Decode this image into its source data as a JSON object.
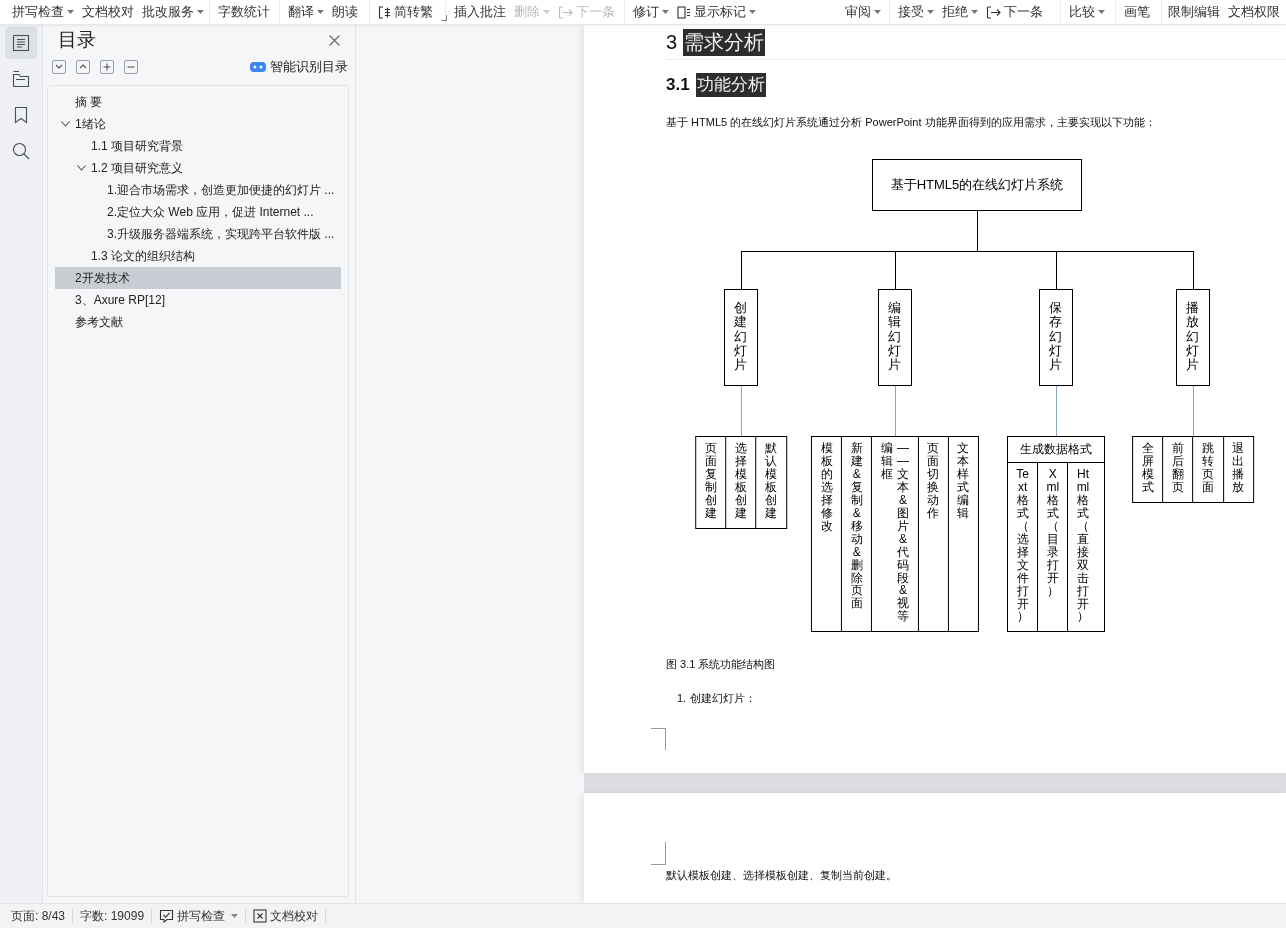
{
  "toolbar": {
    "groups": [
      {
        "launcher": false,
        "items": [
          {
            "kind": "text",
            "label": "拼写检查",
            "dropdown": true,
            "disabled": false
          },
          {
            "kind": "text",
            "label": "文档校对",
            "dropdown": false,
            "disabled": false
          },
          {
            "kind": "text",
            "label": "批改服务",
            "dropdown": true,
            "disabled": false
          }
        ]
      },
      {
        "launcher": false,
        "items": [
          {
            "kind": "text",
            "label": "字数统计",
            "dropdown": false,
            "disabled": false
          }
        ]
      },
      {
        "launcher": false,
        "items": [
          {
            "kind": "text",
            "label": "翻译",
            "dropdown": true,
            "disabled": false
          },
          {
            "kind": "text",
            "label": "朗读",
            "dropdown": false,
            "disabled": false
          }
        ]
      },
      {
        "launcher": true,
        "items": [
          {
            "kind": "convert",
            "label": "简转繁",
            "dropdown": false,
            "disabled": false
          }
        ]
      },
      {
        "launcher": false,
        "items": [
          {
            "kind": "text",
            "label": "插入批注",
            "dropdown": false,
            "disabled": false
          },
          {
            "kind": "text",
            "label": "删除",
            "dropdown": true,
            "disabled": true
          },
          {
            "kind": "next",
            "label": "下一条",
            "dropdown": false,
            "disabled": true
          }
        ]
      },
      {
        "launcher": false,
        "items": [
          {
            "kind": "text",
            "label": "修订",
            "dropdown": true,
            "disabled": false
          },
          {
            "kind": "markup",
            "label": "显示标记",
            "dropdown": true,
            "disabled": false
          },
          {
            "kind": "text",
            "label": "审阅",
            "dropdown": true,
            "disabled": false
          }
        ]
      },
      {
        "launcher": false,
        "items": [
          {
            "kind": "text",
            "label": "接受",
            "dropdown": true,
            "disabled": false
          },
          {
            "kind": "text",
            "label": "拒绝",
            "dropdown": true,
            "disabled": false
          },
          {
            "kind": "next",
            "label": "下一条",
            "dropdown": false,
            "disabled": false
          }
        ]
      },
      {
        "launcher": false,
        "items": [
          {
            "kind": "text",
            "label": "比较",
            "dropdown": true,
            "disabled": false
          }
        ]
      },
      {
        "launcher": false,
        "items": [
          {
            "kind": "text",
            "label": "画笔",
            "dropdown": false,
            "disabled": false
          }
        ]
      },
      {
        "launcher": false,
        "items": [
          {
            "kind": "text",
            "label": "限制编辑",
            "dropdown": false,
            "disabled": false
          },
          {
            "kind": "text",
            "label": "文档权限",
            "dropdown": false,
            "disabled": false
          }
        ]
      }
    ]
  },
  "rail": [
    {
      "kind": "outline",
      "selected": true
    },
    {
      "kind": "sections",
      "selected": false
    },
    {
      "kind": "bookmark",
      "selected": false
    },
    {
      "kind": "search",
      "selected": false
    }
  ],
  "outline_panel": {
    "title": "目录",
    "smart_button": "智能识别目录",
    "items": [
      {
        "label": "摘 要",
        "expanded": false,
        "selected": false
      },
      {
        "label": "1绪论",
        "expanded": true,
        "selected": false,
        "children": [
          {
            "label": "1.1 项目研究背景",
            "expanded": false,
            "selected": false
          },
          {
            "label": "1.2 项目研究意义",
            "expanded": true,
            "selected": false,
            "children": [
              {
                "label": "1.迎合市场需求，创造更加便捷的幻灯片 ...",
                "expanded": false,
                "selected": false
              },
              {
                "label": "2.定位大众 Web 应用，促进 Internet ...",
                "expanded": false,
                "selected": false
              },
              {
                "label": "3.升级服务器端系统，实现跨平台软件版 ...",
                "expanded": false,
                "selected": false
              }
            ]
          },
          {
            "label": "1.3 论文的组织结构",
            "expanded": false,
            "selected": false
          }
        ]
      },
      {
        "label": "2开发技术",
        "expanded": false,
        "selected": true
      },
      {
        "label": "3、Axure RP[12]",
        "expanded": false,
        "selected": false
      },
      {
        "label": "参考文献",
        "expanded": false,
        "selected": false
      }
    ]
  },
  "document": {
    "heading": {
      "number": "3",
      "title": "需求分析",
      "highlighted": true
    },
    "subheading": {
      "number": "3.1",
      "title": "功能分析",
      "highlighted": true
    },
    "intro": "基于 HTML5 的在线幻灯片系统通过分析 PowerPoint 功能界面得到的应用需求，主要实现以下功能：",
    "figure": {
      "root": "基于HTML5的在线幻灯片系统",
      "branches": [
        {
          "label": "创建幻灯片",
          "leaves": [
            {
              "lines": [
                "页面复制创建"
              ]
            },
            {
              "lines": [
                "选择模板创建"
              ]
            },
            {
              "lines": [
                "默认模板创建"
              ]
            }
          ]
        },
        {
          "label": "编辑幻灯片",
          "leaves": [
            {
              "lines": [
                "模板的选择修改"
              ]
            },
            {
              "lines": [
                "新建&复制&移动&删除页面"
              ]
            },
            {
              "lines": [
                "编辑框",
                "——文本&图片&代码段&视等"
              ]
            },
            {
              "lines": [
                "页面切换动作"
              ]
            },
            {
              "lines": [
                "文本样式编辑"
              ]
            }
          ]
        },
        {
          "label": "保存幻灯片",
          "header": "生成数据格式",
          "leaves": [
            {
              "lines": [
                "Text格式（选择文件打开）"
              ]
            },
            {
              "lines": [
                "Xml格式（目录打开）"
              ]
            },
            {
              "lines": [
                "Html格式（直接双击打开）"
              ]
            }
          ]
        },
        {
          "label": "播放幻灯片",
          "leaves": [
            {
              "lines": [
                "全屏模式"
              ]
            },
            {
              "lines": [
                "前后翻页"
              ]
            },
            {
              "lines": [
                "跳转页面"
              ]
            },
            {
              "lines": [
                "退出播放"
              ]
            }
          ]
        }
      ]
    },
    "caption": "图 3.1 系统功能结构图",
    "list_item": {
      "number": "1.",
      "text": "创建幻灯片："
    },
    "next_page_text": "默认模板创建、选择模板创建、复制当前创建。"
  },
  "status_bar": {
    "page": "页面: 8/43",
    "words": "字数: 19099",
    "spell_check": {
      "label": "拼写检查",
      "dropdown": true
    },
    "proofread": "文档校对"
  }
}
